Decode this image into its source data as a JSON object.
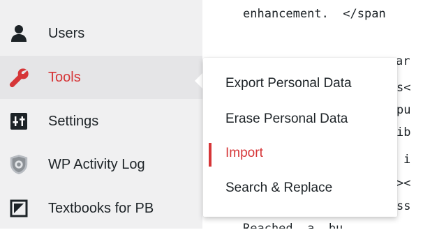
{
  "sidebar": {
    "items": [
      {
        "label": "Users",
        "icon": "users-icon"
      },
      {
        "label": "Tools",
        "icon": "wrench-icon"
      },
      {
        "label": "Settings",
        "icon": "settings-icon"
      },
      {
        "label": "WP Activity Log",
        "icon": "activity-log-shield-icon"
      },
      {
        "label": "Textbooks for PB",
        "icon": "textbooks-icon"
      }
    ]
  },
  "tools_submenu": {
    "items": [
      {
        "label": "Export Personal Data"
      },
      {
        "label": "Erase Personal Data"
      },
      {
        "label": "Import"
      },
      {
        "label": "Search & Replace"
      }
    ]
  },
  "code_editor": {
    "lines": [
      "enhancement.  </span",
      "ar",
      "s<",
      "pu",
      "ib",
      "i",
      "><",
      "ss",
      "Reached  a  bu"
    ]
  },
  "colors": {
    "accent": "#d63638",
    "sidebar_bg": "#f0f0f1",
    "text": "#1d2327"
  }
}
